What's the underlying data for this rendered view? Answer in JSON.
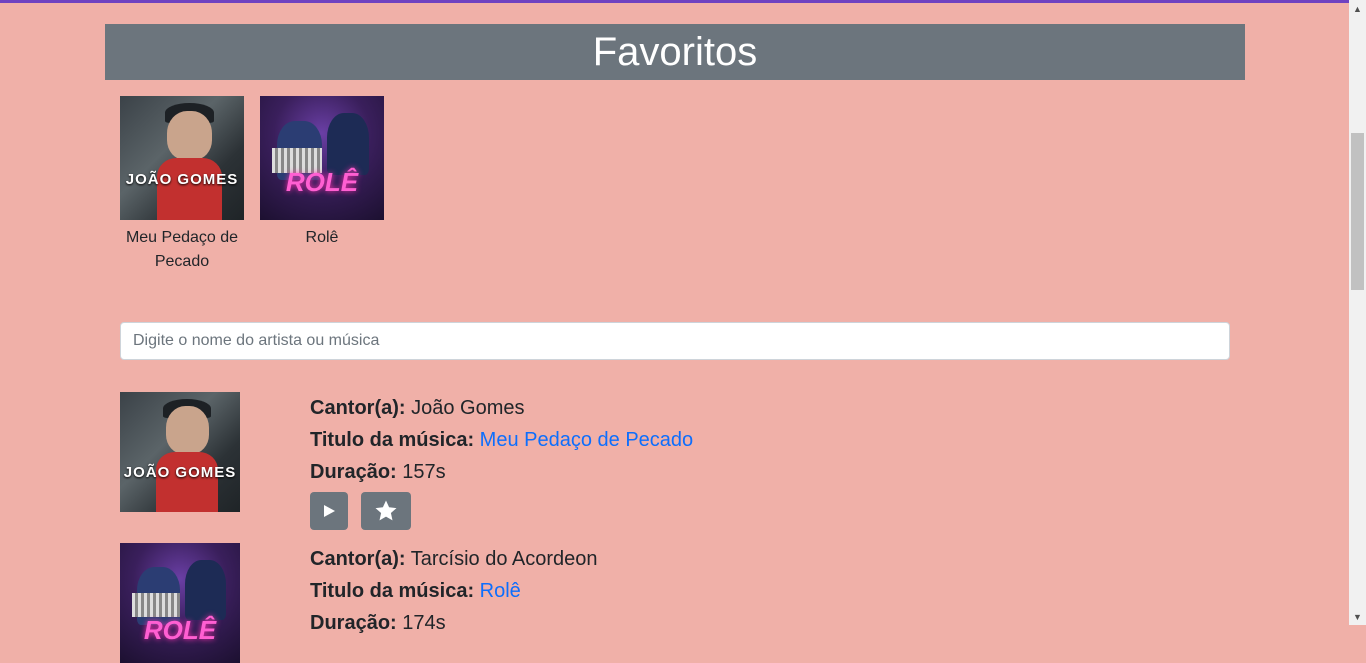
{
  "header": {
    "title": "Favoritos"
  },
  "favorites": [
    {
      "title": "Meu Pedaço de Pecado",
      "cover_text": "JOÃO GOMES"
    },
    {
      "title": "Rolê",
      "cover_text": "ROLÊ"
    }
  ],
  "search": {
    "placeholder": "Digite o nome do artista ou música",
    "value": ""
  },
  "labels": {
    "artist": "Cantor(a):",
    "title": "Titulo da música:",
    "duration": "Duração:"
  },
  "songs": [
    {
      "artist": "João Gomes",
      "title": "Meu Pedaço de Pecado",
      "duration": "157s",
      "cover_text": "JOÃO GOMES"
    },
    {
      "artist": "Tarcísio do Acordeon",
      "title": "Rolê",
      "duration": "174s",
      "cover_text": "ROLÊ"
    }
  ],
  "colors": {
    "background": "#f0b0a8",
    "header": "#6c757d",
    "link": "#0d6efd"
  },
  "icons": {
    "play": "play-icon",
    "favorite": "star-icon"
  }
}
